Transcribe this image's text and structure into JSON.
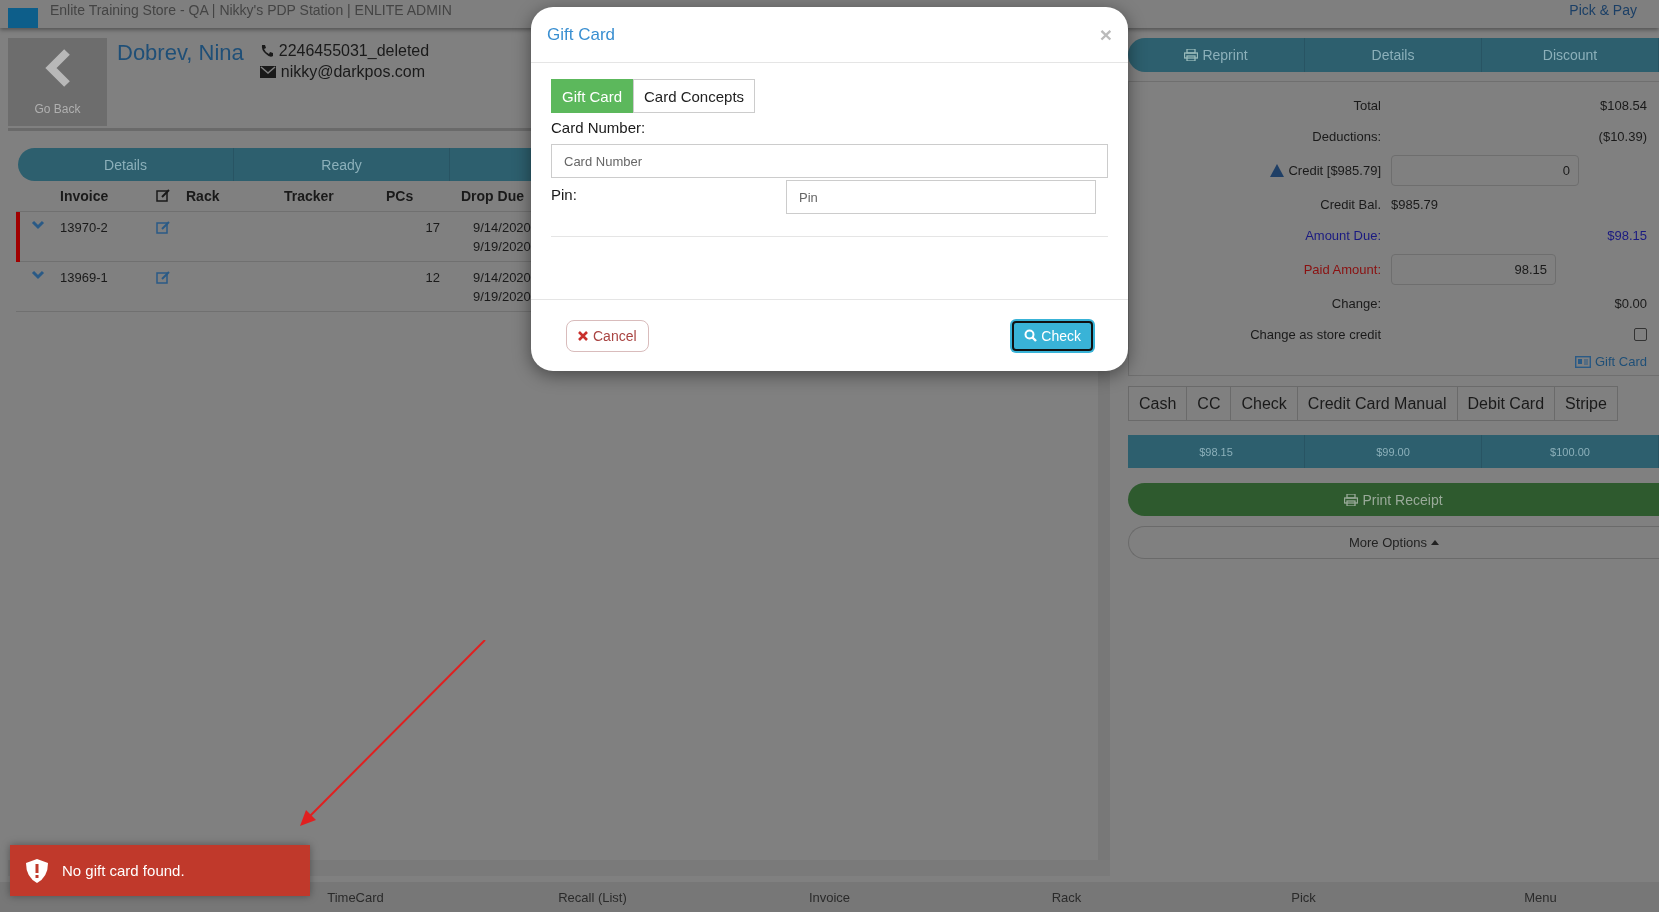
{
  "header": {
    "title": "Enlite Training Store - QA | Nikky's PDP Station | ENLITE ADMIN",
    "right_link": "Pick & Pay"
  },
  "customer": {
    "back_label": "Go Back",
    "name": "Dobrev, Nina",
    "phone": "2246455031_deleted",
    "email": "nikky@darkpos.com"
  },
  "left_tabs": [
    "Details",
    "Ready"
  ],
  "table": {
    "columns": [
      "Invoice",
      "Rack",
      "Tracker",
      "PCs",
      "Drop Due"
    ],
    "rows": [
      {
        "invoice": "13970-2",
        "pcs": "17",
        "dates": [
          "9/14/2020",
          "9/19/2020"
        ],
        "flagged": true
      },
      {
        "invoice": "13969-1",
        "pcs": "12",
        "dates": [
          "9/14/2020",
          "9/19/2020"
        ],
        "flagged": false
      }
    ]
  },
  "right_tabs": [
    "Reprint",
    "Details",
    "Discount"
  ],
  "summary": [
    {
      "kind": "value",
      "label": "Total",
      "value": "$108.54"
    },
    {
      "kind": "value",
      "label": "Deductions:",
      "value": "($10.39)"
    },
    {
      "kind": "credit_input",
      "label": "Credit [$985.79]",
      "value": "0"
    },
    {
      "kind": "balance",
      "label": "Credit Bal.",
      "value": "$985.79"
    },
    {
      "kind": "due",
      "label": "Amount Due:",
      "value": "$98.15"
    },
    {
      "kind": "paid_input",
      "label": "Paid Amount:",
      "value": "98.15"
    },
    {
      "kind": "value",
      "label": "Change:",
      "value": "$0.00"
    },
    {
      "kind": "checkbox",
      "label": "Change as store credit",
      "checked": false
    }
  ],
  "gift_card_link": "Gift Card",
  "payment_methods": [
    "Cash",
    "CC",
    "Check",
    "Credit Card Manual",
    "Debit Card",
    "Stripe"
  ],
  "quick_amounts": [
    "$98.15",
    "$99.00",
    "$100.00"
  ],
  "print_receipt": "Print Receipt",
  "more_options": "More Options",
  "modal": {
    "title": "Gift Card",
    "close": "×",
    "tabs": [
      {
        "label": "Gift Card",
        "selected": true
      },
      {
        "label": "Card Concepts",
        "selected": false
      }
    ],
    "card_label": "Card Number:",
    "card_placeholder": "Card Number",
    "pin_label": "Pin:",
    "pin_placeholder": "Pin",
    "cancel": "Cancel",
    "check": "Check"
  },
  "toast": {
    "message": "No gift card found."
  },
  "bottom_nav": [
    "TimeCard",
    "Recall (List)",
    "Invoice",
    "Rack",
    "Pick",
    "Menu"
  ]
}
